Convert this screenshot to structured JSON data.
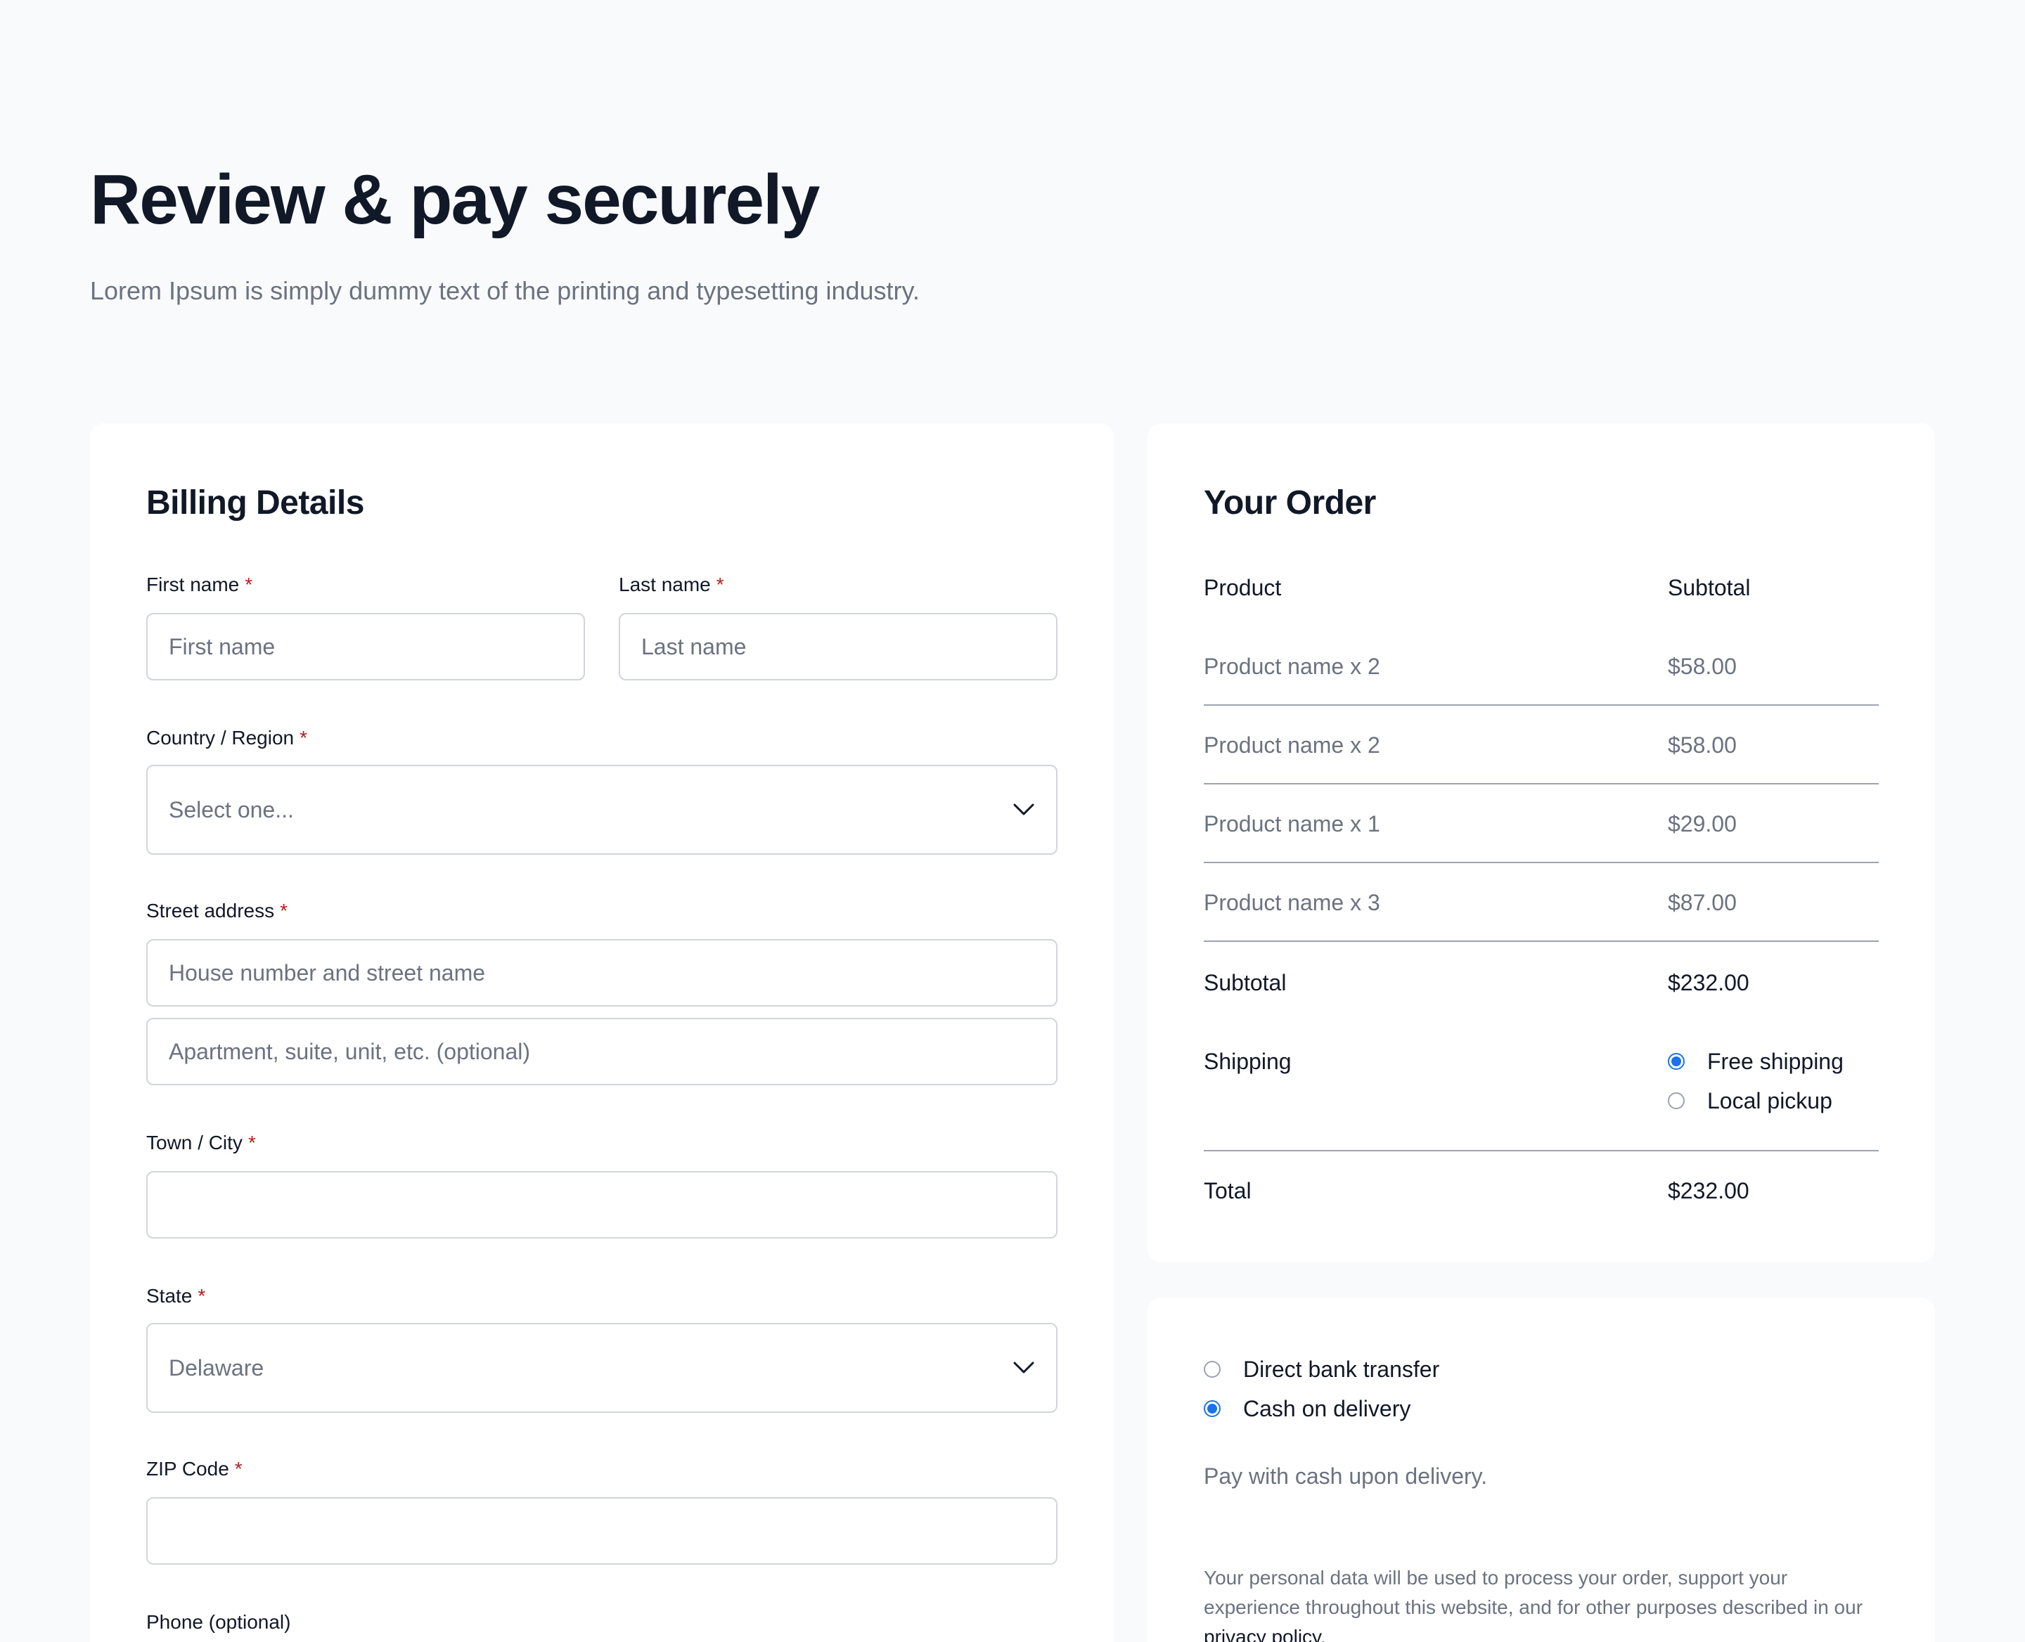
{
  "header": {
    "title": "Review & pay securely",
    "subtitle": "Lorem Ipsum is simply dummy text of the printing and typesetting industry."
  },
  "billing": {
    "title": "Billing Details",
    "required_mark": "*",
    "first_name": {
      "label": "First name",
      "placeholder": "First name",
      "value": ""
    },
    "last_name": {
      "label": "Last name",
      "placeholder": "Last name",
      "value": ""
    },
    "country": {
      "label": "Country / Region",
      "selected": "Select one..."
    },
    "street": {
      "label": "Street address",
      "line1_placeholder": "House number and street name",
      "line2_placeholder": "Apartment, suite, unit, etc. (optional)"
    },
    "city": {
      "label": "Town / City",
      "value": ""
    },
    "state": {
      "label": "State",
      "selected": "Delaware"
    },
    "zip": {
      "label": "ZIP Code",
      "value": ""
    },
    "phone": {
      "label": "Phone (optional)"
    }
  },
  "order": {
    "title": "Your Order",
    "columns": {
      "product": "Product",
      "subtotal": "Subtotal"
    },
    "items": [
      {
        "name": "Product name x 2",
        "subtotal": "$58.00"
      },
      {
        "name": "Product name x 2",
        "subtotal": "$58.00"
      },
      {
        "name": "Product name x 1",
        "subtotal": "$29.00"
      },
      {
        "name": "Product name x 3",
        "subtotal": "$87.00"
      }
    ],
    "subtotal_label": "Subtotal",
    "subtotal_value": "$232.00",
    "shipping_label": "Shipping",
    "shipping_options": [
      {
        "label": "Free shipping",
        "checked": true
      },
      {
        "label": "Local pickup",
        "checked": false
      }
    ],
    "total_label": "Total",
    "total_value": "$232.00"
  },
  "payment": {
    "options": [
      {
        "label": "Direct bank transfer",
        "checked": false
      },
      {
        "label": "Cash on delivery",
        "checked": true
      }
    ],
    "note": "Pay with cash upon delivery.",
    "privacy_text": "Your personal data will be used to process your order, support your experience throughout this website, and for other purposes described in our",
    "privacy_link": "privacy policy",
    "privacy_end": "."
  },
  "colors": {
    "background": "#f9fafc",
    "card": "#ffffff",
    "text_primary": "#111827",
    "text_muted": "#6b7280",
    "required": "#b91c1c",
    "accent": "#1a73e8",
    "border": "#d1d5db",
    "divider": "#9ca3af"
  }
}
